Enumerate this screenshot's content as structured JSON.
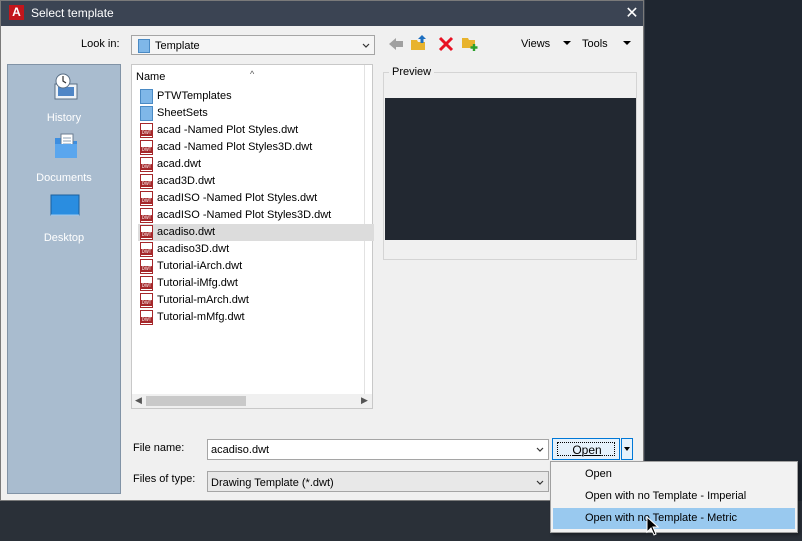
{
  "titlebar": {
    "title": "Select template",
    "app_icon_letter": "A",
    "close_glyph": "✕"
  },
  "look_in": {
    "label": "Look in:",
    "value": "Template"
  },
  "toolbar": {
    "views_label": "Views",
    "tools_label": "Tools"
  },
  "places": [
    {
      "label": "History",
      "icon": "history-icon"
    },
    {
      "label": "Documents",
      "icon": "documents-icon"
    },
    {
      "label": "Desktop",
      "icon": "desktop-icon"
    }
  ],
  "file_list": {
    "column_header": "Name",
    "sort_glyph": "^",
    "items": [
      {
        "name": "PTWTemplates",
        "type": "folder"
      },
      {
        "name": "SheetSets",
        "type": "folder"
      },
      {
        "name": "acad -Named Plot Styles.dwt",
        "type": "dwt"
      },
      {
        "name": "acad -Named Plot Styles3D.dwt",
        "type": "dwt"
      },
      {
        "name": "acad.dwt",
        "type": "dwt"
      },
      {
        "name": "acad3D.dwt",
        "type": "dwt"
      },
      {
        "name": "acadISO -Named Plot Styles.dwt",
        "type": "dwt"
      },
      {
        "name": "acadISO -Named Plot Styles3D.dwt",
        "type": "dwt"
      },
      {
        "name": "acadiso.dwt",
        "type": "dwt",
        "selected": true
      },
      {
        "name": "acadiso3D.dwt",
        "type": "dwt"
      },
      {
        "name": "Tutorial-iArch.dwt",
        "type": "dwt"
      },
      {
        "name": "Tutorial-iMfg.dwt",
        "type": "dwt"
      },
      {
        "name": "Tutorial-mArch.dwt",
        "type": "dwt"
      },
      {
        "name": "Tutorial-mMfg.dwt",
        "type": "dwt"
      }
    ],
    "dwt_badge": "DWT"
  },
  "preview": {
    "label": "Preview"
  },
  "file_name": {
    "label": "File name:",
    "value": "acadiso.dwt"
  },
  "files_of_type": {
    "label": "Files of type:",
    "value": "Drawing Template (*.dwt)"
  },
  "open_button": {
    "label": "Open"
  },
  "open_menu": {
    "items": [
      {
        "label": "Open"
      },
      {
        "label": "Open with no Template - Imperial"
      },
      {
        "label": "Open with no Template - Metric",
        "highlighted": true
      }
    ]
  },
  "colors": {
    "titlebar": "#3b4453",
    "places_bg": "#a9bccf",
    "selection": "#dcdcdc",
    "menu_highlight": "#99c9ef",
    "accent": "#0078d7",
    "delete_red": "#e81123",
    "app_red": "#c3161c"
  }
}
